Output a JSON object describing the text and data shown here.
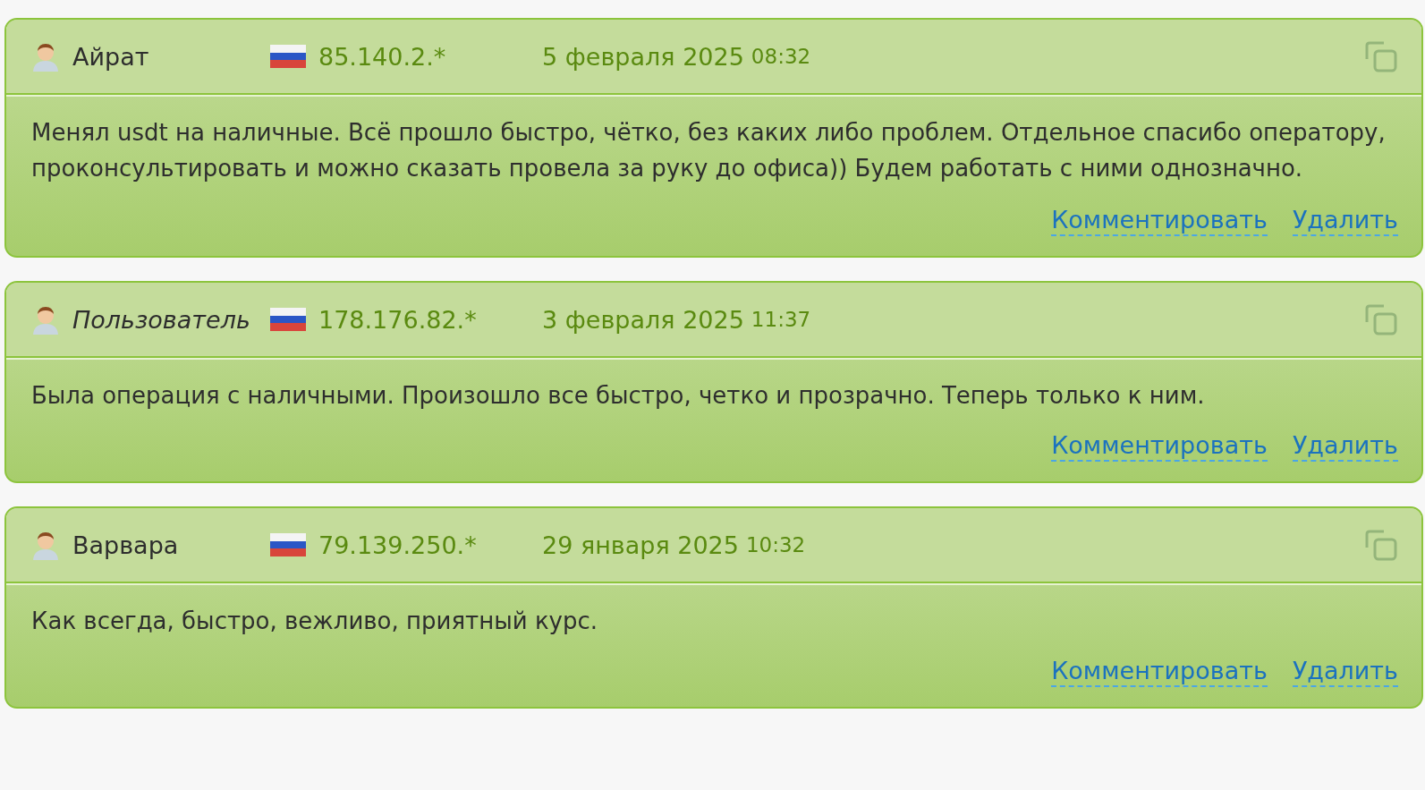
{
  "reviews": [
    {
      "author": "Айрат",
      "guest": false,
      "ip": "85.140.2.*",
      "date": "5 февраля 2025",
      "time": "08:32",
      "text": "Менял usdt на наличные. Всё прошло быстро, чётко, без каких либо проблем. Отдельное спасибо оператору, проконсультировать и можно сказать провела за руку до офиса)) Будем работать с ними однозначно.",
      "actions": [
        "Комментировать",
        "Удалить"
      ]
    },
    {
      "author": "Пользователь",
      "guest": true,
      "ip": "178.176.82.*",
      "date": "3 февраля 2025",
      "time": "11:37",
      "text": "Была операция с наличными. Произошло все быстро, четко и прозрачно. Теперь только к ним.",
      "actions": [
        "Комментировать",
        "Удалить"
      ]
    },
    {
      "author": "Варвара",
      "guest": false,
      "ip": "79.139.250.*",
      "date": "29 января 2025",
      "time": "10:32",
      "text": "Как всегда, быстро, вежливо, приятный курс.",
      "actions": [
        "Комментировать",
        "Удалить"
      ]
    }
  ]
}
